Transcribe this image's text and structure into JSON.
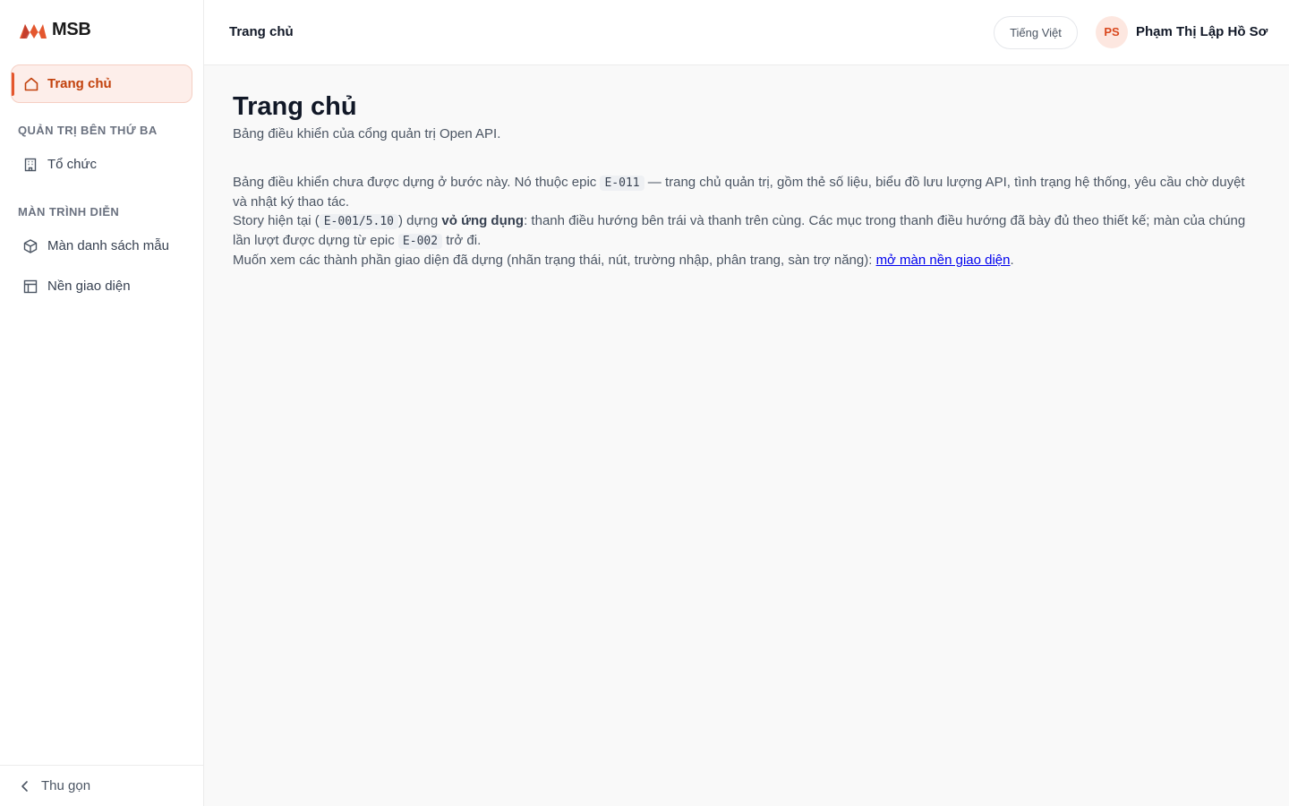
{
  "brand": {
    "name": "MSB",
    "accent": "#e4572e"
  },
  "sidebar": {
    "active_item": {
      "label": "Trang chủ",
      "icon": "home-icon"
    },
    "sections": [
      {
        "title": "QUẢN TRỊ BÊN THỨ BA",
        "items": [
          {
            "label": "Tổ chức",
            "icon": "building-icon"
          }
        ]
      },
      {
        "title": "MÀN TRÌNH DIỄN",
        "items": [
          {
            "label": "Màn danh sách mẫu",
            "icon": "box-icon"
          },
          {
            "label": "Nền giao diện",
            "icon": "layout-icon"
          }
        ]
      }
    ],
    "collapse_label": "Thu gọn"
  },
  "topbar": {
    "breadcrumb": "Trang chủ",
    "language_button": "Tiếng Việt",
    "user_initials": "PS",
    "user_name": "Phạm Thị Lập Hồ Sơ"
  },
  "main": {
    "title": "Trang chủ",
    "subtitle": "Bảng điều khiển của cổng quản trị Open API.",
    "p1": {
      "pre": "Bảng điều khiển chưa được dựng ở bước này. Nó thuộc epic ",
      "code": "E-011",
      "post": " — trang chủ quản trị, gồm thẻ số liệu, biểu đồ lưu lượng API, tình trạng hệ thống, yêu cầu chờ duyệt và nhật ký thao tác."
    },
    "p2": {
      "pre": "Story hiện tại (",
      "code1": "E-001/5.10",
      "mid1": ") dựng ",
      "strong": "vỏ ứng dụng",
      "mid2": ": thanh điều hướng bên trái và thanh trên cùng. Các mục trong thanh điều hướng đã bày đủ theo thiết kế; màn của chúng lần lượt được dựng từ epic ",
      "code2": "E-002",
      "post": " trở đi."
    },
    "p3": {
      "pre": "Muốn xem các thành phần giao diện đã dựng (nhãn trạng thái, nút, trường nhập, phân trang, sàn trợ năng): ",
      "link": "mở màn nền giao diện",
      "post": "."
    }
  }
}
